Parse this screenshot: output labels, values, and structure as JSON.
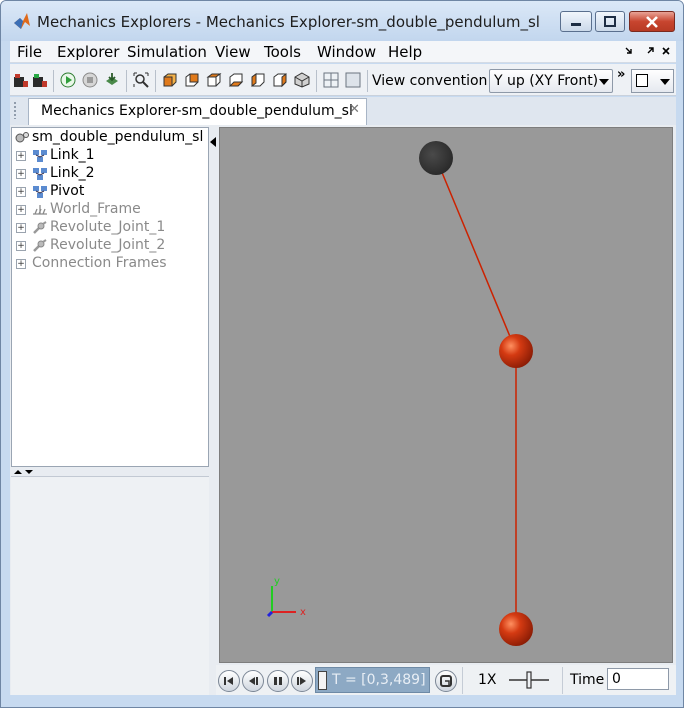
{
  "window": {
    "title": "Mechanics Explorers - Mechanics Explorer-sm_double_pendulum_sl"
  },
  "menu": [
    "File",
    "Explorer",
    "Simulation",
    "View",
    "Tools",
    "Window",
    "Help"
  ],
  "toolbar": {
    "view_convention_label": "View convention:",
    "view_convention_value": "Y up (XY Front)",
    "overflow_glyph": "»"
  },
  "tab": {
    "label": "Mechanics Explorer-sm_double_pendulum_sl",
    "close_glyph": "✕"
  },
  "tree": {
    "root": "sm_double_pendulum_sl",
    "items": [
      {
        "label": "Link_1",
        "muted": false,
        "icon": "subsystem-icon"
      },
      {
        "label": "Link_2",
        "muted": false,
        "icon": "subsystem-icon"
      },
      {
        "label": "Pivot",
        "muted": false,
        "icon": "subsystem-icon"
      },
      {
        "label": "World_Frame",
        "muted": true,
        "icon": "world-frame-icon"
      },
      {
        "label": "Revolute_Joint_1",
        "muted": true,
        "icon": "joint-icon"
      },
      {
        "label": "Revolute_Joint_2",
        "muted": true,
        "icon": "joint-icon"
      },
      {
        "label": "Connection Frames",
        "muted": true,
        "icon": null
      }
    ]
  },
  "viewport": {
    "axis_labels": {
      "x": "x",
      "y": "y"
    },
    "colors": {
      "background": "#999999",
      "pivot": "#2e2e2e",
      "bob": "#d43a12",
      "link": "#cc2200"
    }
  },
  "playback": {
    "time_range": "T = [0,3,489]",
    "speed": "1X",
    "time_label": "Time",
    "time_value": "0"
  }
}
